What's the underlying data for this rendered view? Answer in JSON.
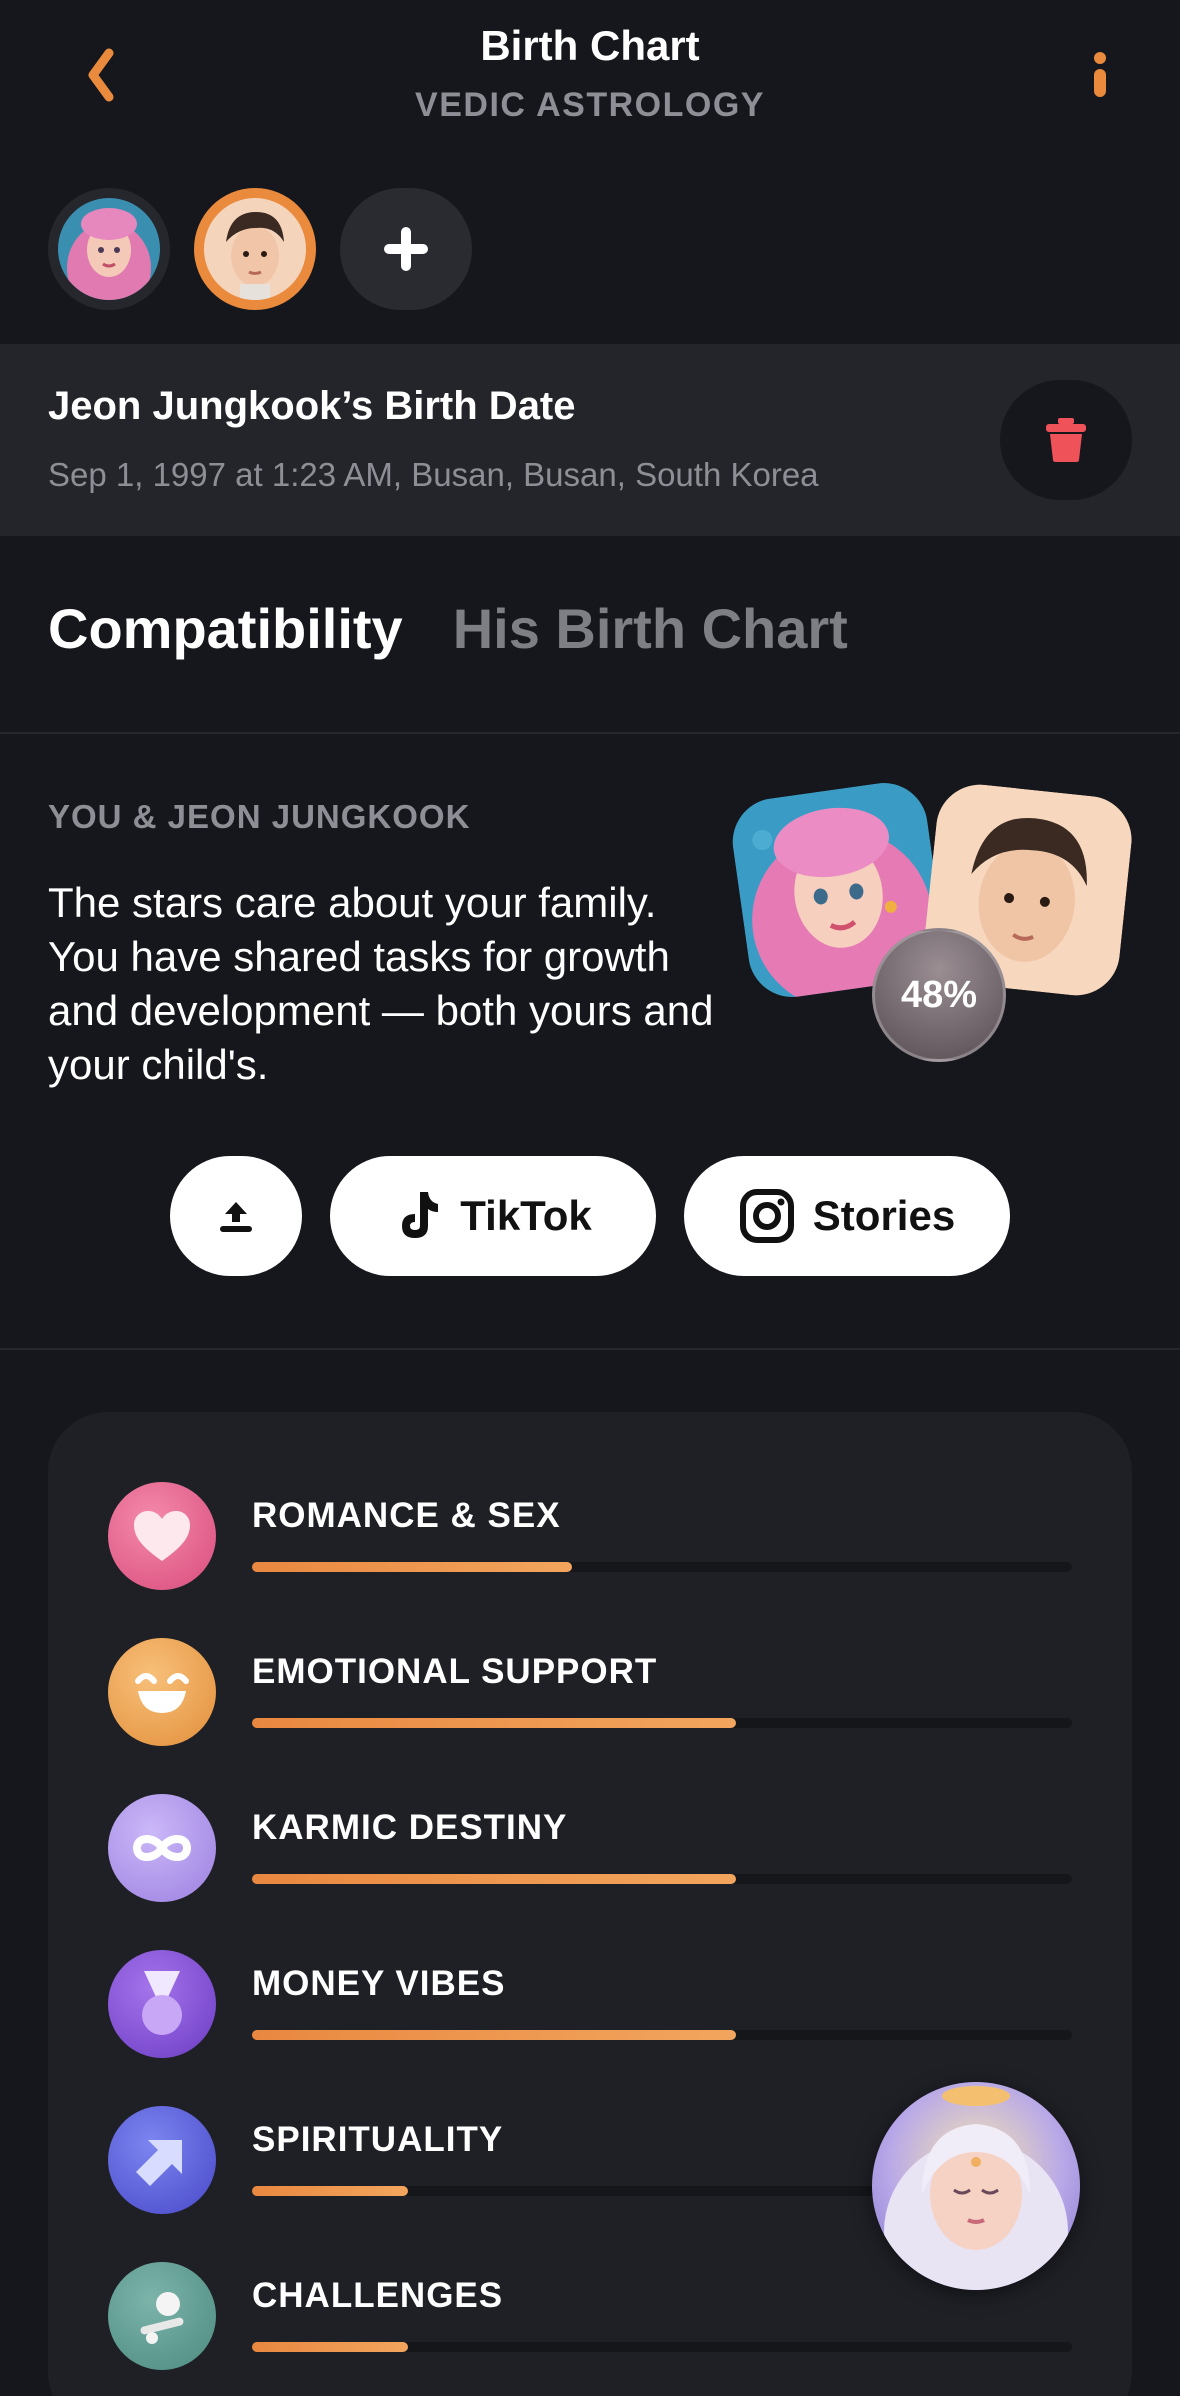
{
  "header": {
    "title": "Birth Chart",
    "subtitle": "VEDIC ASTROLOGY"
  },
  "icons": {
    "back": "chevron-left-icon",
    "info": "info-icon",
    "add": "plus-icon",
    "delete": "trash-icon",
    "share": "upload-icon",
    "tiktok": "tiktok-icon",
    "instagram": "instagram-icon"
  },
  "birth": {
    "title": "Jeon Jungkook’s Birth Date",
    "details": "Sep 1, 1997 at 1:23 AM, Busan, Busan, South Korea"
  },
  "tabs": [
    {
      "label": "Compatibility",
      "active": true
    },
    {
      "label": "His Birth Chart",
      "active": false
    }
  ],
  "compatibility": {
    "label": "YOU & JEON JUNGKOOK",
    "text": "The stars care about your family. You have shared tasks for growth and development — both yours and your child's.",
    "percent_label": "48%",
    "percent": 48
  },
  "share": {
    "tiktok_label": "TikTok",
    "stories_label": "Stories"
  },
  "categories": [
    {
      "label": "ROMANCE & SEX",
      "icon": "heart-icon",
      "value": 0.39,
      "color": "#e9688f"
    },
    {
      "label": "EMOTIONAL SUPPORT",
      "icon": "smile-icon",
      "value": 0.59,
      "color": "#f0a45a"
    },
    {
      "label": "KARMIC DESTINY",
      "icon": "infinity-icon",
      "value": 0.59,
      "color": "#b39cf0"
    },
    {
      "label": "MONEY VIBES",
      "icon": "medal-icon",
      "value": 0.59,
      "color": "#8a5ad8"
    },
    {
      "label": "SPIRITUALITY",
      "icon": "arrow-up-right-icon",
      "value": 0.19,
      "color": "#5a66e0"
    },
    {
      "label": "CHALLENGES",
      "icon": "challenge-icon",
      "value": 0.19,
      "color": "#5c9a90"
    }
  ],
  "colors": {
    "accent": "#e98a3c",
    "background": "#16171c",
    "danger": "#f0525a"
  }
}
